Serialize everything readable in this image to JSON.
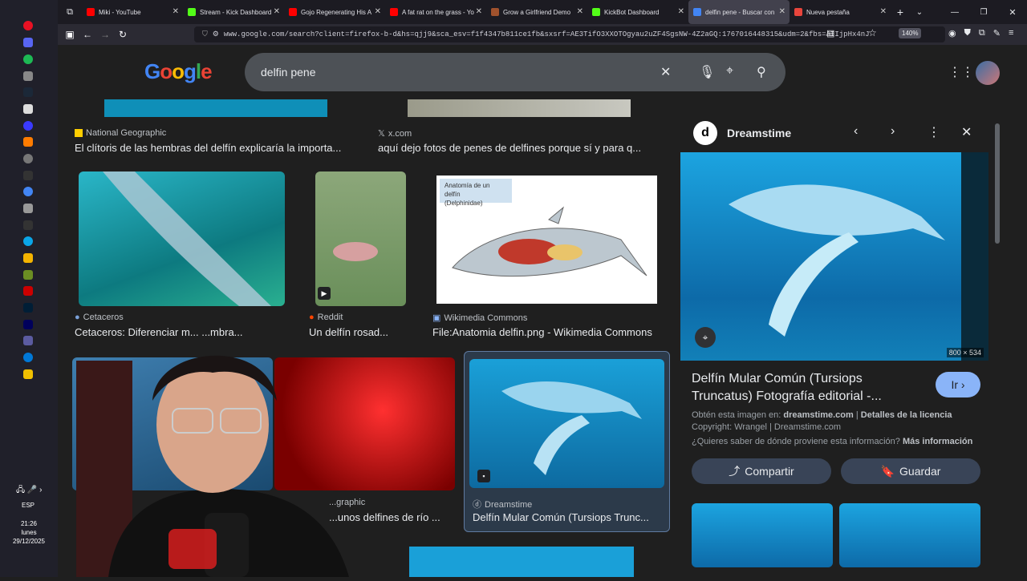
{
  "tabs": [
    {
      "label": "Miki - YouTube",
      "color": "#ff0000"
    },
    {
      "label": "Stream - Kick Dashboard",
      "color": "#53fc18"
    },
    {
      "label": "Gojo Regenerating His A",
      "color": "#ff0000"
    },
    {
      "label": "A fat rat on the grass - Yo",
      "color": "#ff0000"
    },
    {
      "label": "Grow a Girlfriend Demo",
      "color": "#a0522d"
    },
    {
      "label": "KickBot Dashboard",
      "color": "#53fc18"
    },
    {
      "label": "delfin pene - Buscar con",
      "color": "#4285f4"
    },
    {
      "label": "Nueva pestaña",
      "color": "#e8453c"
    }
  ],
  "url": "www.google.com/search?client=firefox-b-d&hs=qjj9&sca_esv=f1f4347b811ce1fb&sxsrf=AE3TifO3XXOTOgyau2uZF4SgsNW-4Z2aGQ:1767016448315&udm=2&fbs=AIIjpHx4nJ",
  "zoom": "140%",
  "search": {
    "query": "delfin pene"
  },
  "logo": "Google",
  "clock": {
    "time": "21:26",
    "day": "lunes",
    "date": "29/12/2025",
    "lang": "ESP"
  },
  "results": [
    {
      "source": "National Geographic",
      "title": "El clítoris de las hembras del delfín explicaría la importa..."
    },
    {
      "source": "x.com",
      "title": "aquí dejo fotos de penes de delfines porque sí y para q..."
    },
    {
      "source": "Cetaceros",
      "title": "Cetaceros: Diferenciar m... ...mbra..."
    },
    {
      "source": "Reddit",
      "title": "Un delfín rosad..."
    },
    {
      "source": "Wikimedia Commons",
      "title": "File:Anatomia delfin.png - Wikimedia Commons"
    },
    {
      "source": "...graphic",
      "title": "...unos delfines de río ..."
    },
    {
      "source": "Dreamstime",
      "title": "Delfín Mular Común (Tursiops Trunc..."
    }
  ],
  "anatomy": {
    "title": "Anatomía de un delfín",
    "subtitle": "(Delphinidae)"
  },
  "panel": {
    "site": "Dreamstime",
    "dims": "800 × 534",
    "title": "Delfín Mular Común (Tursiops Truncatus) Fotografía editorial -...",
    "go_label": "Ir",
    "obtain_prefix": "Obtén esta imagen en:",
    "obtain_link": "dreamstime.com",
    "license": "Detalles de la licencia",
    "copyright": "Copyright: Wrangel | Dreamstime.com",
    "origin_q": "¿Quieres saber de dónde proviene esta información?",
    "origin_link": "Más información",
    "share": "Compartir",
    "save": "Guardar"
  }
}
